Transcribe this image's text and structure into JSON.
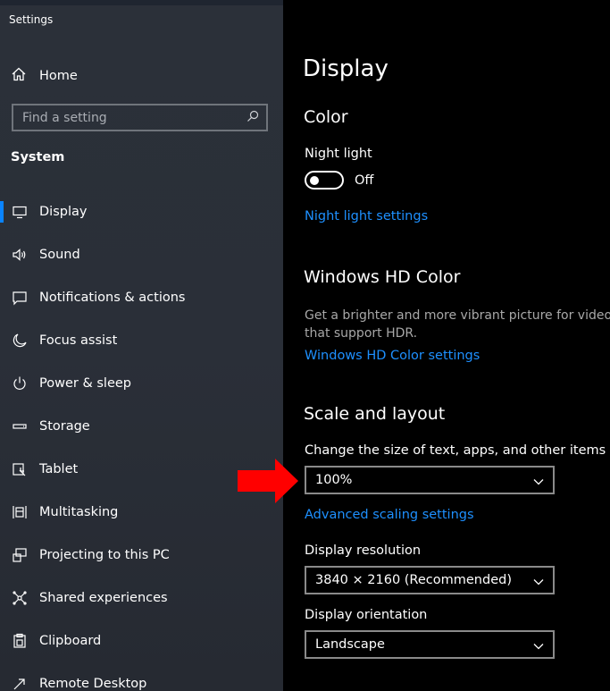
{
  "window": {
    "title": "Settings"
  },
  "sidebar": {
    "home_label": "Home",
    "search": {
      "placeholder": "Find a setting"
    },
    "section_title": "System",
    "items": [
      {
        "label": "Display",
        "icon": "monitor-icon"
      },
      {
        "label": "Sound",
        "icon": "speaker-icon"
      },
      {
        "label": "Notifications & actions",
        "icon": "notification-icon"
      },
      {
        "label": "Focus assist",
        "icon": "moon-icon"
      },
      {
        "label": "Power & sleep",
        "icon": "power-icon"
      },
      {
        "label": "Storage",
        "icon": "storage-icon"
      },
      {
        "label": "Tablet",
        "icon": "tablet-icon"
      },
      {
        "label": "Multitasking",
        "icon": "multitasking-icon"
      },
      {
        "label": "Projecting to this PC",
        "icon": "projecting-icon"
      },
      {
        "label": "Shared experiences",
        "icon": "shared-icon"
      },
      {
        "label": "Clipboard",
        "icon": "clipboard-icon"
      },
      {
        "label": "Remote Desktop",
        "icon": "remote-desktop-icon"
      }
    ],
    "active_item": "Display"
  },
  "main": {
    "title": "Display",
    "color": {
      "heading": "Color",
      "night_light_label": "Night light",
      "night_light_state": "Off",
      "night_light_link": "Night light settings"
    },
    "hdr": {
      "heading": "Windows HD Color",
      "description_line1": "Get a brighter and more vibrant picture for videos, g",
      "description_line2": "that support HDR.",
      "link": "Windows HD Color settings"
    },
    "scale": {
      "heading": "Scale and layout",
      "size_label": "Change the size of text, apps, and other items",
      "size_value": "100%",
      "advanced_link": "Advanced scaling settings",
      "resolution_label": "Display resolution",
      "resolution_value": "3840 × 2160 (Recommended)",
      "orientation_label": "Display orientation",
      "orientation_value": "Landscape"
    }
  },
  "colors": {
    "accent_blue": "#1e90ff",
    "annotation_arrow": "#ff0000",
    "sidebar_bg": "#2b3039",
    "main_bg": "#000000"
  }
}
